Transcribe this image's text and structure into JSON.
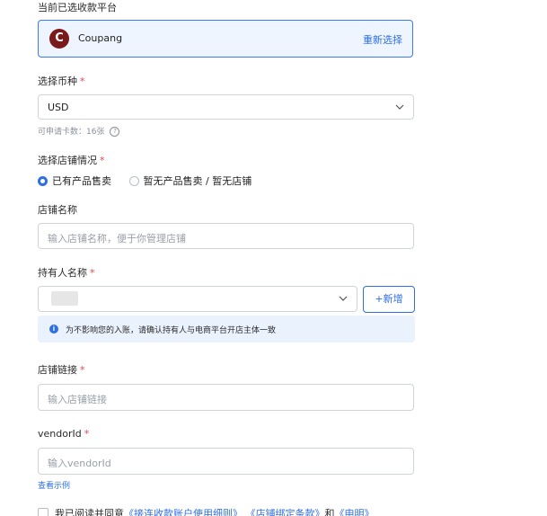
{
  "section_title": "当前已选收款平台",
  "platform": {
    "logo_letter": "C",
    "name": "Coupang",
    "reselect_label": "重新选择",
    "logo_color": "#7a1b1b"
  },
  "currency": {
    "label": "选择币种",
    "value": "USD",
    "hint": "可申请卡数：16张"
  },
  "store_status": {
    "label": "选择店铺情况",
    "options": [
      "已有产品售卖",
      "暂无产品售卖 / 暂无店铺"
    ],
    "selected_index": 0
  },
  "store_name": {
    "label": "店铺名称",
    "placeholder": "输入店铺名称，便于你管理店铺"
  },
  "holder": {
    "label": "持有人名称",
    "add_label": "+新增",
    "notice": "为不影响您的入账，请确认持有人与电商平台开店主体一致"
  },
  "store_link": {
    "label": "店铺链接",
    "placeholder": "输入店铺链接"
  },
  "vendor": {
    "label": "vendorId",
    "placeholder": "输入vendorId",
    "example_link": "查看示例"
  },
  "agreement": {
    "prefix": "我已阅读并同意",
    "link1": "《接连收款账户使用细则》",
    "link2": "《店铺绑定条款》",
    "conj": "和",
    "link3": "《申明》"
  },
  "colors": {
    "accent": "#2f6fe4",
    "required": "#e5484d"
  }
}
